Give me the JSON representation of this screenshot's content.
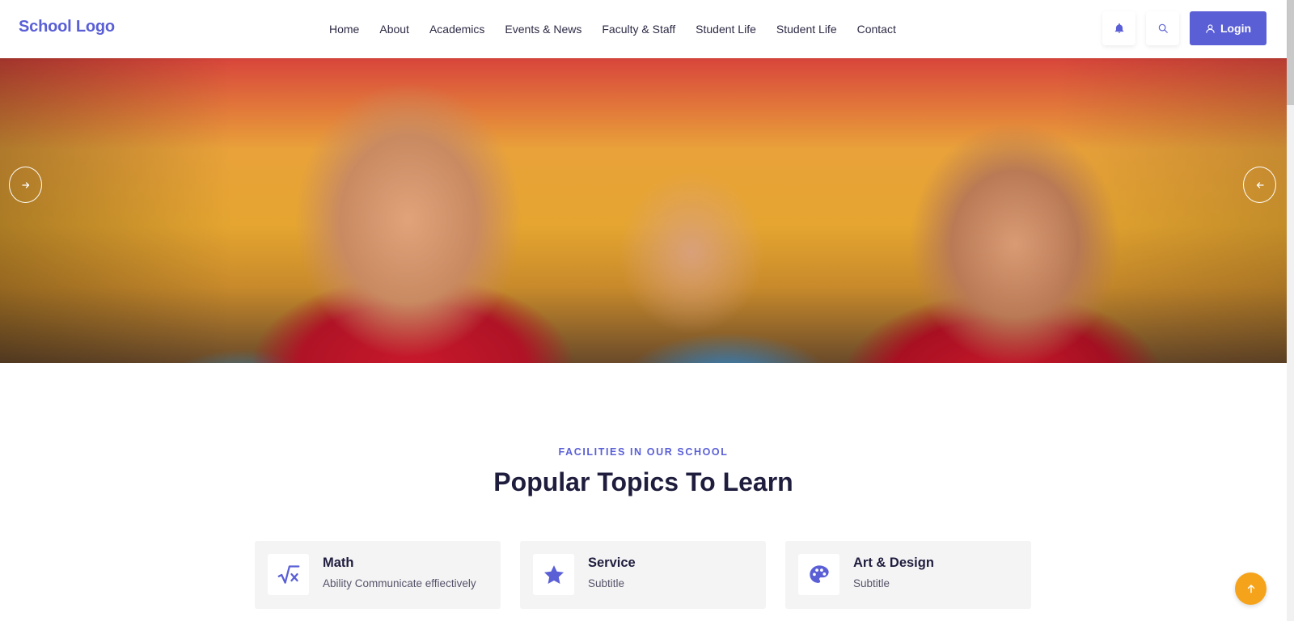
{
  "header": {
    "logo": "School Logo",
    "nav": [
      "Home",
      "About",
      "Academics",
      "Events & News",
      "Faculty & Staff",
      "Student Life",
      "Student Life",
      "Contact"
    ],
    "login_label": "Login",
    "icons": {
      "bell": "bell-icon",
      "search": "search-icon",
      "user": "user-icon"
    }
  },
  "hero": {
    "prev_icon": "arrow-right-icon",
    "next_icon": "arrow-left-icon"
  },
  "section": {
    "eyebrow": "FACILITIES IN OUR SCHOOL",
    "title": "Popular Topics To Learn",
    "cards": [
      {
        "title": "Math",
        "subtitle": "Ability Communicate effiectively",
        "icon": "square-root-icon"
      },
      {
        "title": "Service",
        "subtitle": "Subtitle",
        "icon": "star-icon"
      },
      {
        "title": "Art & Design",
        "subtitle": "Subtitle",
        "icon": "palette-icon"
      }
    ]
  },
  "colors": {
    "accent": "#5a5fd6",
    "heading": "#1f1d3d",
    "card_bg": "#f4f4f5",
    "scroll_top": "#f5a31a"
  }
}
